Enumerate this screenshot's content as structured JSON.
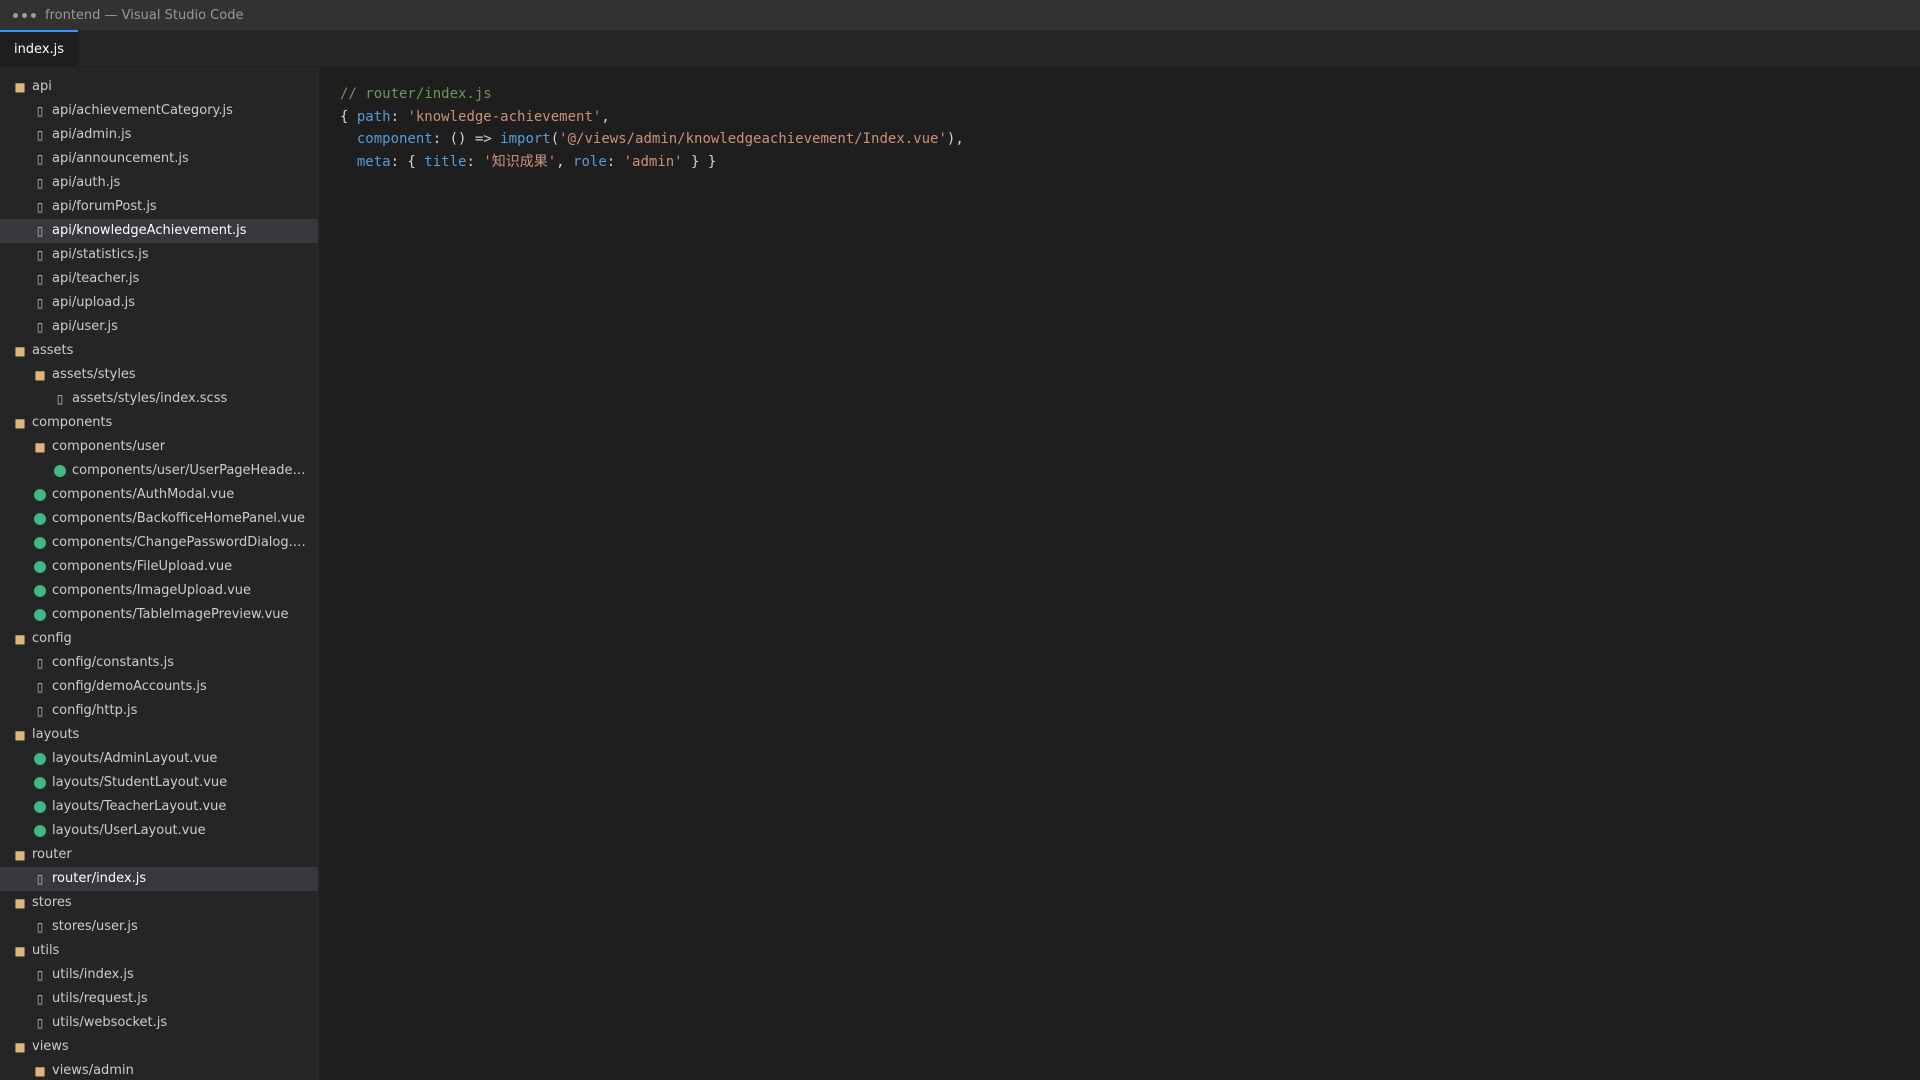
{
  "window": {
    "title": "frontend — Visual Studio Code"
  },
  "tabs": [
    {
      "label": "index.js",
      "active": true
    }
  ],
  "explorer": {
    "items": [
      {
        "label": "api",
        "type": "folder",
        "level": 0,
        "selected": false
      },
      {
        "label": "api/achievementCategory.js",
        "type": "file",
        "level": 1,
        "selected": false
      },
      {
        "label": "api/admin.js",
        "type": "file",
        "level": 1,
        "selected": false
      },
      {
        "label": "api/announcement.js",
        "type": "file",
        "level": 1,
        "selected": false
      },
      {
        "label": "api/auth.js",
        "type": "file",
        "level": 1,
        "selected": false
      },
      {
        "label": "api/forumPost.js",
        "type": "file",
        "level": 1,
        "selected": false
      },
      {
        "label": "api/knowledgeAchievement.js",
        "type": "file",
        "level": 1,
        "selected": true
      },
      {
        "label": "api/statistics.js",
        "type": "file",
        "level": 1,
        "selected": false
      },
      {
        "label": "api/teacher.js",
        "type": "file",
        "level": 1,
        "selected": false
      },
      {
        "label": "api/upload.js",
        "type": "file",
        "level": 1,
        "selected": false
      },
      {
        "label": "api/user.js",
        "type": "file",
        "level": 1,
        "selected": false
      },
      {
        "label": "assets",
        "type": "folder",
        "level": 0,
        "selected": false
      },
      {
        "label": "assets/styles",
        "type": "folder",
        "level": 1,
        "selected": false
      },
      {
        "label": "assets/styles/index.scss",
        "type": "file",
        "level": 2,
        "selected": false
      },
      {
        "label": "components",
        "type": "folder",
        "level": 0,
        "selected": false
      },
      {
        "label": "components/user",
        "type": "folder",
        "level": 1,
        "selected": false
      },
      {
        "label": "components/user/UserPageHeader.vue",
        "type": "vue",
        "level": 2,
        "selected": false
      },
      {
        "label": "components/AuthModal.vue",
        "type": "vue",
        "level": 1,
        "selected": false
      },
      {
        "label": "components/BackofficeHomePanel.vue",
        "type": "vue",
        "level": 1,
        "selected": false
      },
      {
        "label": "components/ChangePasswordDialog.vue",
        "type": "vue",
        "level": 1,
        "selected": false
      },
      {
        "label": "components/FileUpload.vue",
        "type": "vue",
        "level": 1,
        "selected": false
      },
      {
        "label": "components/ImageUpload.vue",
        "type": "vue",
        "level": 1,
        "selected": false
      },
      {
        "label": "components/TableImagePreview.vue",
        "type": "vue",
        "level": 1,
        "selected": false
      },
      {
        "label": "config",
        "type": "folder",
        "level": 0,
        "selected": false
      },
      {
        "label": "config/constants.js",
        "type": "file",
        "level": 1,
        "selected": false
      },
      {
        "label": "config/demoAccounts.js",
        "type": "file",
        "level": 1,
        "selected": false
      },
      {
        "label": "config/http.js",
        "type": "file",
        "level": 1,
        "selected": false
      },
      {
        "label": "layouts",
        "type": "folder",
        "level": 0,
        "selected": false
      },
      {
        "label": "layouts/AdminLayout.vue",
        "type": "vue",
        "level": 1,
        "selected": false
      },
      {
        "label": "layouts/StudentLayout.vue",
        "type": "vue",
        "level": 1,
        "selected": false
      },
      {
        "label": "layouts/TeacherLayout.vue",
        "type": "vue",
        "level": 1,
        "selected": false
      },
      {
        "label": "layouts/UserLayout.vue",
        "type": "vue",
        "level": 1,
        "selected": false
      },
      {
        "label": "router",
        "type": "folder",
        "level": 0,
        "selected": false
      },
      {
        "label": "router/index.js",
        "type": "file",
        "level": 1,
        "selected": true
      },
      {
        "label": "stores",
        "type": "folder",
        "level": 0,
        "selected": false
      },
      {
        "label": "stores/user.js",
        "type": "file",
        "level": 1,
        "selected": false
      },
      {
        "label": "utils",
        "type": "folder",
        "level": 0,
        "selected": false
      },
      {
        "label": "utils/index.js",
        "type": "file",
        "level": 1,
        "selected": false
      },
      {
        "label": "utils/request.js",
        "type": "file",
        "level": 1,
        "selected": false
      },
      {
        "label": "utils/websocket.js",
        "type": "file",
        "level": 1,
        "selected": false
      },
      {
        "label": "views",
        "type": "folder",
        "level": 0,
        "selected": false
      },
      {
        "label": "views/admin",
        "type": "folder",
        "level": 1,
        "selected": false
      }
    ]
  },
  "editor": {
    "lines": [
      [
        {
          "t": "comment",
          "v": "// router/index.js"
        }
      ],
      [
        {
          "t": "punc",
          "v": "{ "
        },
        {
          "t": "key",
          "v": "path"
        },
        {
          "t": "punc",
          "v": ": "
        },
        {
          "t": "str",
          "v": "'knowledge-achievement'"
        },
        {
          "t": "punc",
          "v": ","
        }
      ],
      [
        {
          "t": "punc",
          "v": "  "
        },
        {
          "t": "key",
          "v": "component"
        },
        {
          "t": "punc",
          "v": ": () => "
        },
        {
          "t": "fn",
          "v": "import"
        },
        {
          "t": "punc",
          "v": "("
        },
        {
          "t": "str",
          "v": "'@/views/admin/knowledgeachievement/Index.vue'"
        },
        {
          "t": "punc",
          "v": "),"
        }
      ],
      [
        {
          "t": "punc",
          "v": "  "
        },
        {
          "t": "key",
          "v": "meta"
        },
        {
          "t": "punc",
          "v": ": { "
        },
        {
          "t": "key",
          "v": "title"
        },
        {
          "t": "punc",
          "v": ": "
        },
        {
          "t": "str",
          "v": "'知识成果'"
        },
        {
          "t": "punc",
          "v": ", "
        },
        {
          "t": "key",
          "v": "role"
        },
        {
          "t": "punc",
          "v": ": "
        },
        {
          "t": "str",
          "v": "'admin'"
        },
        {
          "t": "punc",
          "v": " } }"
        }
      ]
    ]
  },
  "colors": {
    "accent": "#3794ff",
    "folder": "#dcb67a",
    "vue": "#41b883",
    "comment": "#6a9955",
    "keyword": "#569cd6",
    "string": "#ce9178"
  }
}
